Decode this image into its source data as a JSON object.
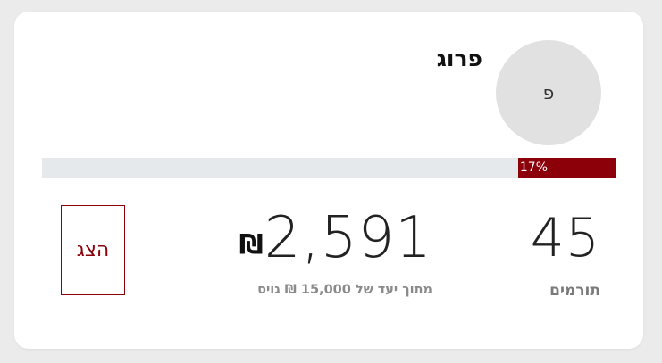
{
  "campaign": {
    "avatar_initial": "פ",
    "name": "פרוג"
  },
  "progress": {
    "percent": 17,
    "label": "17%"
  },
  "stats": {
    "donors_count": "45",
    "donors_label": "תורמים",
    "raised_currency": "₪",
    "raised_amount": "2,591",
    "goal_text": "מתוך יעד של 15,000 ₪ גויס"
  },
  "actions": {
    "view_label": "הצג"
  },
  "colors": {
    "accent": "#8b0009",
    "progress_track": "#e6e9ec",
    "avatar_bg": "#e1e1e1"
  }
}
